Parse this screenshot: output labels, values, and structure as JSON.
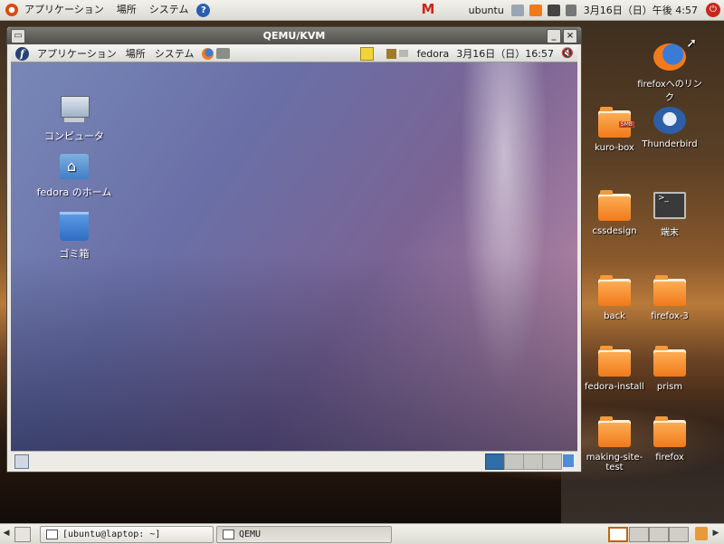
{
  "host_panel": {
    "menus": [
      "アプリケーション",
      "場所",
      "システム"
    ],
    "username": "ubuntu",
    "clock": "3月16日（日）午後 4:57"
  },
  "host_desktop_icons": [
    {
      "label": "firefoxへのリンク",
      "icon": "firefox-link-icon"
    },
    {
      "label": "kuro-box",
      "icon": "smb-folder-icon"
    },
    {
      "label": "Thunderbird",
      "icon": "thunderbird-icon"
    },
    {
      "label": "cssdesign",
      "icon": "folder-icon"
    },
    {
      "label": "端末",
      "icon": "terminal-icon"
    },
    {
      "label": "back",
      "icon": "folder-icon"
    },
    {
      "label": "firefox-3",
      "icon": "folder-icon"
    },
    {
      "label": "fedora-install",
      "icon": "folder-icon"
    },
    {
      "label": "prism",
      "icon": "folder-icon"
    },
    {
      "label": "making-site-test",
      "icon": "folder-icon"
    },
    {
      "label": "firefox",
      "icon": "folder-icon"
    }
  ],
  "qemu_window": {
    "title": "QEMU/KVM",
    "guest_panel": {
      "menus": [
        "アプリケーション",
        "場所",
        "システム"
      ],
      "username": "fedora",
      "clock": "3月16日（日）16:57"
    },
    "guest_icons": [
      {
        "label": "コンピュータ",
        "icon": "computer-icon"
      },
      {
        "label": "fedora のホーム",
        "icon": "home-folder-icon"
      },
      {
        "label": "ゴミ箱",
        "icon": "trash-icon"
      }
    ],
    "workspaces": {
      "count": 4,
      "active": 1
    }
  },
  "taskbar": {
    "tasks": [
      {
        "label": "[ubuntu@laptop: ~]",
        "pressed": false
      },
      {
        "label": "QEMU",
        "pressed": true
      }
    ],
    "workspaces": {
      "count": 4,
      "active": 1
    }
  },
  "colors": {
    "ubuntu_orange": "#dd4814",
    "fedora_blue": "#294172",
    "active_workspace": "#2f6ea8"
  }
}
